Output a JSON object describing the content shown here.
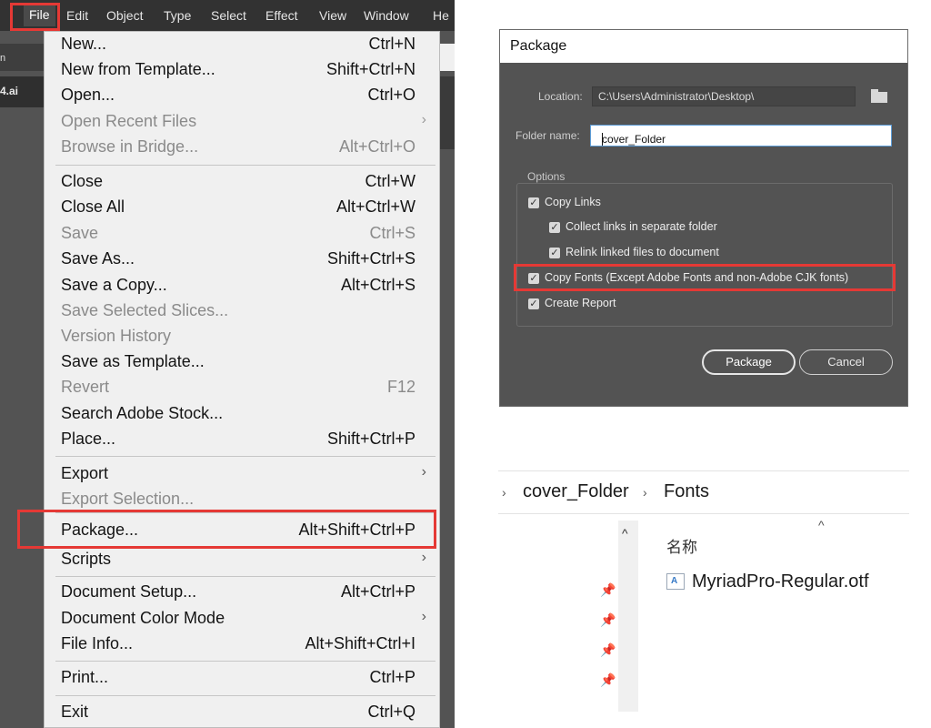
{
  "menubar": {
    "items": [
      "File",
      "Edit",
      "Object",
      "Type",
      "Select",
      "Effect",
      "View",
      "Window",
      "He"
    ]
  },
  "doc": {
    "left_letter": "n",
    "tab_label": "4.ai"
  },
  "file_menu": {
    "items": [
      {
        "label": "New...",
        "shortcut": "Ctrl+N",
        "enabled": true
      },
      {
        "label": "New from Template...",
        "shortcut": "Shift+Ctrl+N",
        "enabled": true
      },
      {
        "label": "Open...",
        "shortcut": "Ctrl+O",
        "enabled": true
      },
      {
        "label": "Open Recent Files",
        "shortcut": "",
        "enabled": false,
        "submenu": true
      },
      {
        "label": "Browse in Bridge...",
        "shortcut": "Alt+Ctrl+O",
        "enabled": false
      },
      {
        "label": "Close",
        "shortcut": "Ctrl+W",
        "enabled": true
      },
      {
        "label": "Close All",
        "shortcut": "Alt+Ctrl+W",
        "enabled": true
      },
      {
        "label": "Save",
        "shortcut": "Ctrl+S",
        "enabled": false
      },
      {
        "label": "Save As...",
        "shortcut": "Shift+Ctrl+S",
        "enabled": true
      },
      {
        "label": "Save a Copy...",
        "shortcut": "Alt+Ctrl+S",
        "enabled": true
      },
      {
        "label": "Save Selected Slices...",
        "shortcut": "",
        "enabled": false
      },
      {
        "label": "Version History",
        "shortcut": "",
        "enabled": false
      },
      {
        "label": "Save as Template...",
        "shortcut": "",
        "enabled": true
      },
      {
        "label": "Revert",
        "shortcut": "F12",
        "enabled": false
      },
      {
        "label": "Search Adobe Stock...",
        "shortcut": "",
        "enabled": true
      },
      {
        "label": "Place...",
        "shortcut": "Shift+Ctrl+P",
        "enabled": true
      },
      {
        "label": "Export",
        "shortcut": "",
        "enabled": true,
        "submenu": true
      },
      {
        "label": "Export Selection...",
        "shortcut": "",
        "enabled": false
      },
      {
        "label": "Package...",
        "shortcut": "Alt+Shift+Ctrl+P",
        "enabled": true,
        "highlighted": true
      },
      {
        "label": "Scripts",
        "shortcut": "",
        "enabled": true,
        "submenu": true
      },
      {
        "label": "Document Setup...",
        "shortcut": "Alt+Ctrl+P",
        "enabled": true
      },
      {
        "label": "Document Color Mode",
        "shortcut": "",
        "enabled": true,
        "submenu": true
      },
      {
        "label": "File Info...",
        "shortcut": "Alt+Shift+Ctrl+I",
        "enabled": true
      },
      {
        "label": "Print...",
        "shortcut": "Ctrl+P",
        "enabled": true
      },
      {
        "label": "Exit",
        "shortcut": "Ctrl+Q",
        "enabled": true
      }
    ],
    "submenu_glyph": "›"
  },
  "package_dialog": {
    "title": "Package",
    "location_label": "Location:",
    "location_value": "C:\\Users\\Administrator\\Desktop\\",
    "folder_name_label": "Folder name:",
    "folder_name_value": "cover_Folder",
    "options_legend": "Options",
    "options": [
      {
        "label": "Copy Links",
        "checked": true
      },
      {
        "label": "Collect links in separate folder",
        "checked": true
      },
      {
        "label": "Relink linked files to document",
        "checked": true
      },
      {
        "label": "Copy Fonts (Except Adobe Fonts and non-Adobe CJK fonts)",
        "checked": true,
        "highlighted": true
      },
      {
        "label": "Create Report",
        "checked": true
      }
    ],
    "check_glyph": "✓",
    "package_button": "Package",
    "cancel_button": "Cancel"
  },
  "explorer": {
    "breadcrumb": [
      "cover_Folder",
      "Fonts"
    ],
    "crumb_sep": "›",
    "column_header": "名称",
    "sort_glyph": "^",
    "up_glyph": "^",
    "pin_glyph": "📌",
    "file_icon_letter": "A",
    "files": [
      "MyriadPro-Regular.otf"
    ]
  },
  "colors": {
    "highlight": "#e53935",
    "dialog_bg": "#535353",
    "menu_bg": "#f0f0f0"
  }
}
